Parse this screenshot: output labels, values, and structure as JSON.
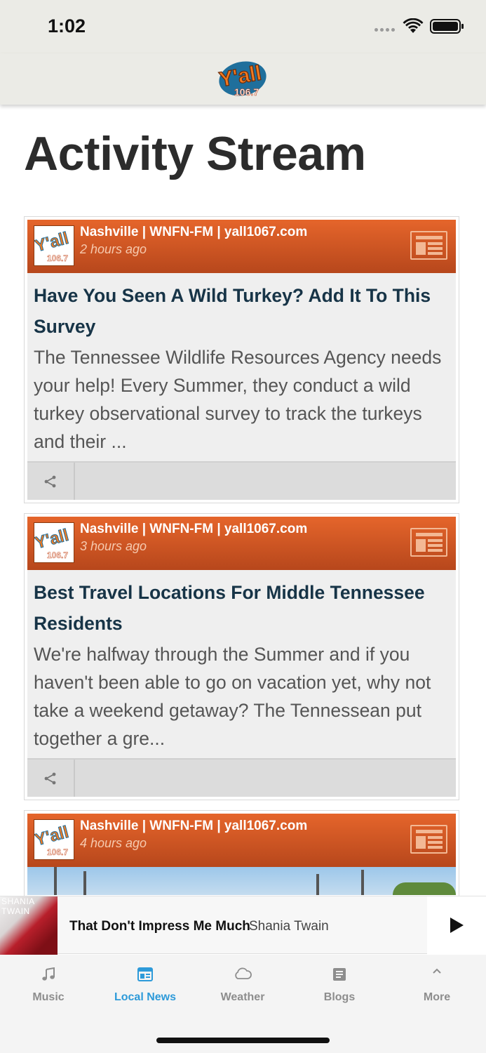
{
  "status_bar": {
    "time": "1:02"
  },
  "header": {
    "logo_text": "Y'all",
    "logo_freq": "106.7"
  },
  "page": {
    "title": "Activity Stream"
  },
  "cards": [
    {
      "source": "Nashville | WNFN-FM | yall1067.com",
      "time": "2 hours ago",
      "title": "Have You Seen A Wild Turkey? Add It To This Survey",
      "description": "The Tennessee Wildlife Resources Agency needs your help! Every Summer, they conduct a wild turkey observational survey to track the turkeys and their ..."
    },
    {
      "source": "Nashville | WNFN-FM | yall1067.com",
      "time": "3 hours ago",
      "title": "Best Travel Locations For Middle Tennessee Residents",
      "description": "We're halfway through the Summer and if you haven't been able to go on vacation yet, why not take a weekend getaway? The Tennessean put together a gre..."
    },
    {
      "source": "Nashville | WNFN-FM | yall1067.com",
      "time": "4 hours ago"
    }
  ],
  "now_playing": {
    "album_text": "SHANIA TWAIN",
    "song": "That Don't Impress Me Much",
    "artist": "Shania Twain"
  },
  "tabs": [
    {
      "label": "Music",
      "icon": "music-note-icon",
      "active": false
    },
    {
      "label": "Local News",
      "icon": "news-icon",
      "active": true
    },
    {
      "label": "Weather",
      "icon": "cloud-icon",
      "active": false
    },
    {
      "label": "Blogs",
      "icon": "document-icon",
      "active": false
    },
    {
      "label": "More",
      "icon": "chevron-up-icon",
      "active": false
    }
  ],
  "colors": {
    "brand_orange": "#d95a24",
    "active_tab": "#2d9ad9",
    "title_navy": "#173447"
  }
}
